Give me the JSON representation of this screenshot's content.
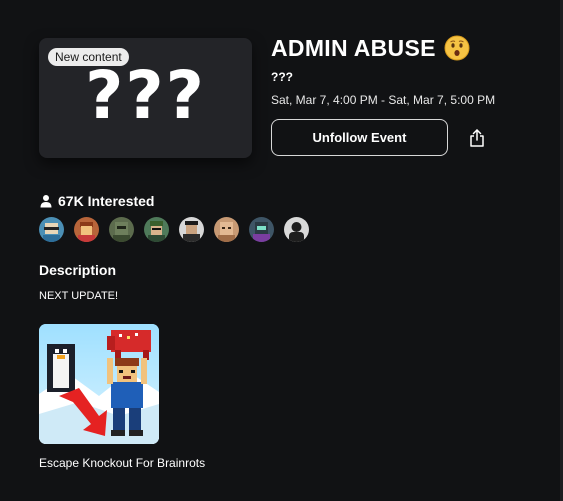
{
  "event": {
    "badge": "New content",
    "thumbnail_text": "???",
    "title": "ADMIN ABUSE",
    "title_emoji": "hushed-face-emoji",
    "subtitle": "???",
    "datetime": "Sat, Mar 7, 4:00 PM - Sat, Mar 7, 5:00 PM",
    "unfollow_label": "Unfollow Event",
    "share_icon": "share-icon"
  },
  "interest": {
    "icon": "person-icon",
    "text": "67K Interested",
    "avatars": [
      {
        "name": "avatar-1",
        "bg": "#4b8fb5"
      },
      {
        "name": "avatar-2",
        "bg": "#b8653a"
      },
      {
        "name": "avatar-3",
        "bg": "#5c6b4d"
      },
      {
        "name": "avatar-4",
        "bg": "#4f7a5a"
      },
      {
        "name": "avatar-5",
        "bg": "#2b2b2b"
      },
      {
        "name": "avatar-6",
        "bg": "#c89a74"
      },
      {
        "name": "avatar-7",
        "bg": "#3e5566"
      },
      {
        "name": "avatar-8",
        "bg": "#1e1e1e"
      }
    ]
  },
  "description": {
    "heading": "Description",
    "text": "NEXT UPDATE!"
  },
  "game": {
    "name": "Escape Knockout For Brainrots"
  },
  "colors": {
    "background": "#111214",
    "card": "#232428",
    "text": "#ffffff",
    "button_border": "#d7d7d7"
  }
}
